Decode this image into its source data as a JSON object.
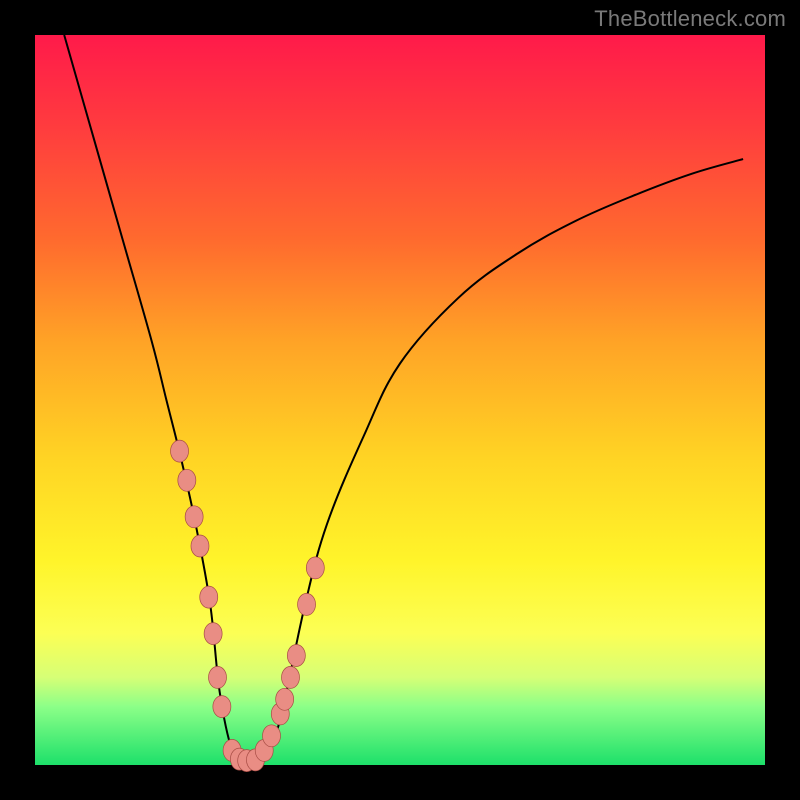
{
  "watermark": "TheBottleneck.com",
  "colors": {
    "gradient_top": "#ff1a4a",
    "gradient_bottom": "#1de06a",
    "curve": "#000000",
    "marker_fill": "#e98d84",
    "marker_stroke": "#a74c44",
    "background": "#000000"
  },
  "chart_data": {
    "type": "line",
    "title": "",
    "xlabel": "",
    "ylabel": "",
    "xlim": [
      0,
      100
    ],
    "ylim": [
      0,
      100
    ],
    "series": [
      {
        "name": "bottleneck-curve",
        "x": [
          4,
          8,
          12,
          16,
          18,
          20,
          22,
          24,
          25.3,
          27,
          28.5,
          30,
          31,
          32.5,
          34,
          37,
          40,
          45,
          50,
          58,
          66,
          74,
          82,
          90,
          97
        ],
        "y": [
          100,
          86,
          72,
          58,
          50,
          42,
          33,
          22,
          10,
          2,
          0.5,
          0.5,
          1,
          3,
          8,
          22,
          33,
          45,
          55,
          64,
          70,
          74.5,
          78,
          81,
          83
        ]
      }
    ],
    "markers": {
      "name": "highlighted-points",
      "x": [
        19.8,
        20.8,
        21.8,
        22.6,
        23.8,
        24.4,
        25.0,
        25.6,
        27.0,
        28.0,
        29.0,
        30.2,
        31.4,
        32.4,
        33.6,
        34.2,
        35.0,
        35.8,
        37.2,
        38.4
      ],
      "y": [
        43,
        39,
        34,
        30,
        23,
        18,
        12,
        8,
        2,
        0.8,
        0.6,
        0.7,
        2,
        4,
        7,
        9,
        12,
        15,
        22,
        27
      ]
    }
  }
}
